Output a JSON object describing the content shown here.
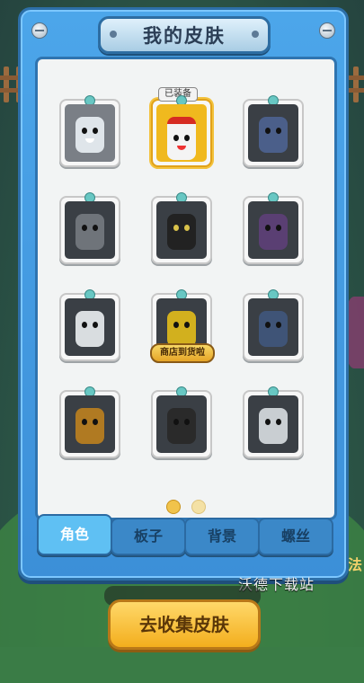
{
  "title": "我的皮肤",
  "equipped_tag": "已装备",
  "ribbon_label": "商店到货啦",
  "tabs": [
    {
      "label": "角色",
      "active": true
    },
    {
      "label": "板子",
      "active": false
    },
    {
      "label": "背景",
      "active": false
    },
    {
      "label": "螺丝",
      "active": false
    }
  ],
  "collect_button": "去收集皮肤",
  "watermark": "沃德下载站",
  "pager": {
    "current": 1,
    "total": 2
  },
  "colors": {
    "panel_blue": "#4ca6ea",
    "accent_gold": "#f3ae1d",
    "slot_dark": "#3a3f45"
  },
  "background_side_text": "法"
}
